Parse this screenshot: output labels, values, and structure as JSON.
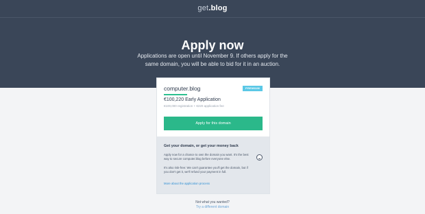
{
  "header": {
    "logo_prefix": "get",
    "logo_suffix": ".blog"
  },
  "hero": {
    "title": "Apply now",
    "subtitle": "Applications are open until November 9. If others apply for the same domain, you will be able to bid for it in an auction."
  },
  "card": {
    "domain": "computer.blog",
    "badge": "PREMIUM",
    "price": "€100,220 Early Application",
    "fees": "€100,000 registration + €220 application fee",
    "apply_label": "Apply for this domain"
  },
  "guarantee": {
    "title": "Get your domain, or get your money back",
    "text1": "Apply now for a chance to own the domain you want. It's the best way to secure computer.blog before everyone else.",
    "text2": "It's also risk-free: We can't guarantee you'll get the domain, but if you don't get it, we'll refund your payment in full.",
    "link": "More about the application process",
    "icon": "smile-icon"
  },
  "footer": {
    "question": "Not what you wanted?",
    "link": "Try a different domain"
  },
  "colors": {
    "hero_bg": "#3a4658",
    "accent_green": "#2bb88a",
    "badge_blue": "#5bc8e6",
    "link_blue": "#2f8fd3"
  }
}
